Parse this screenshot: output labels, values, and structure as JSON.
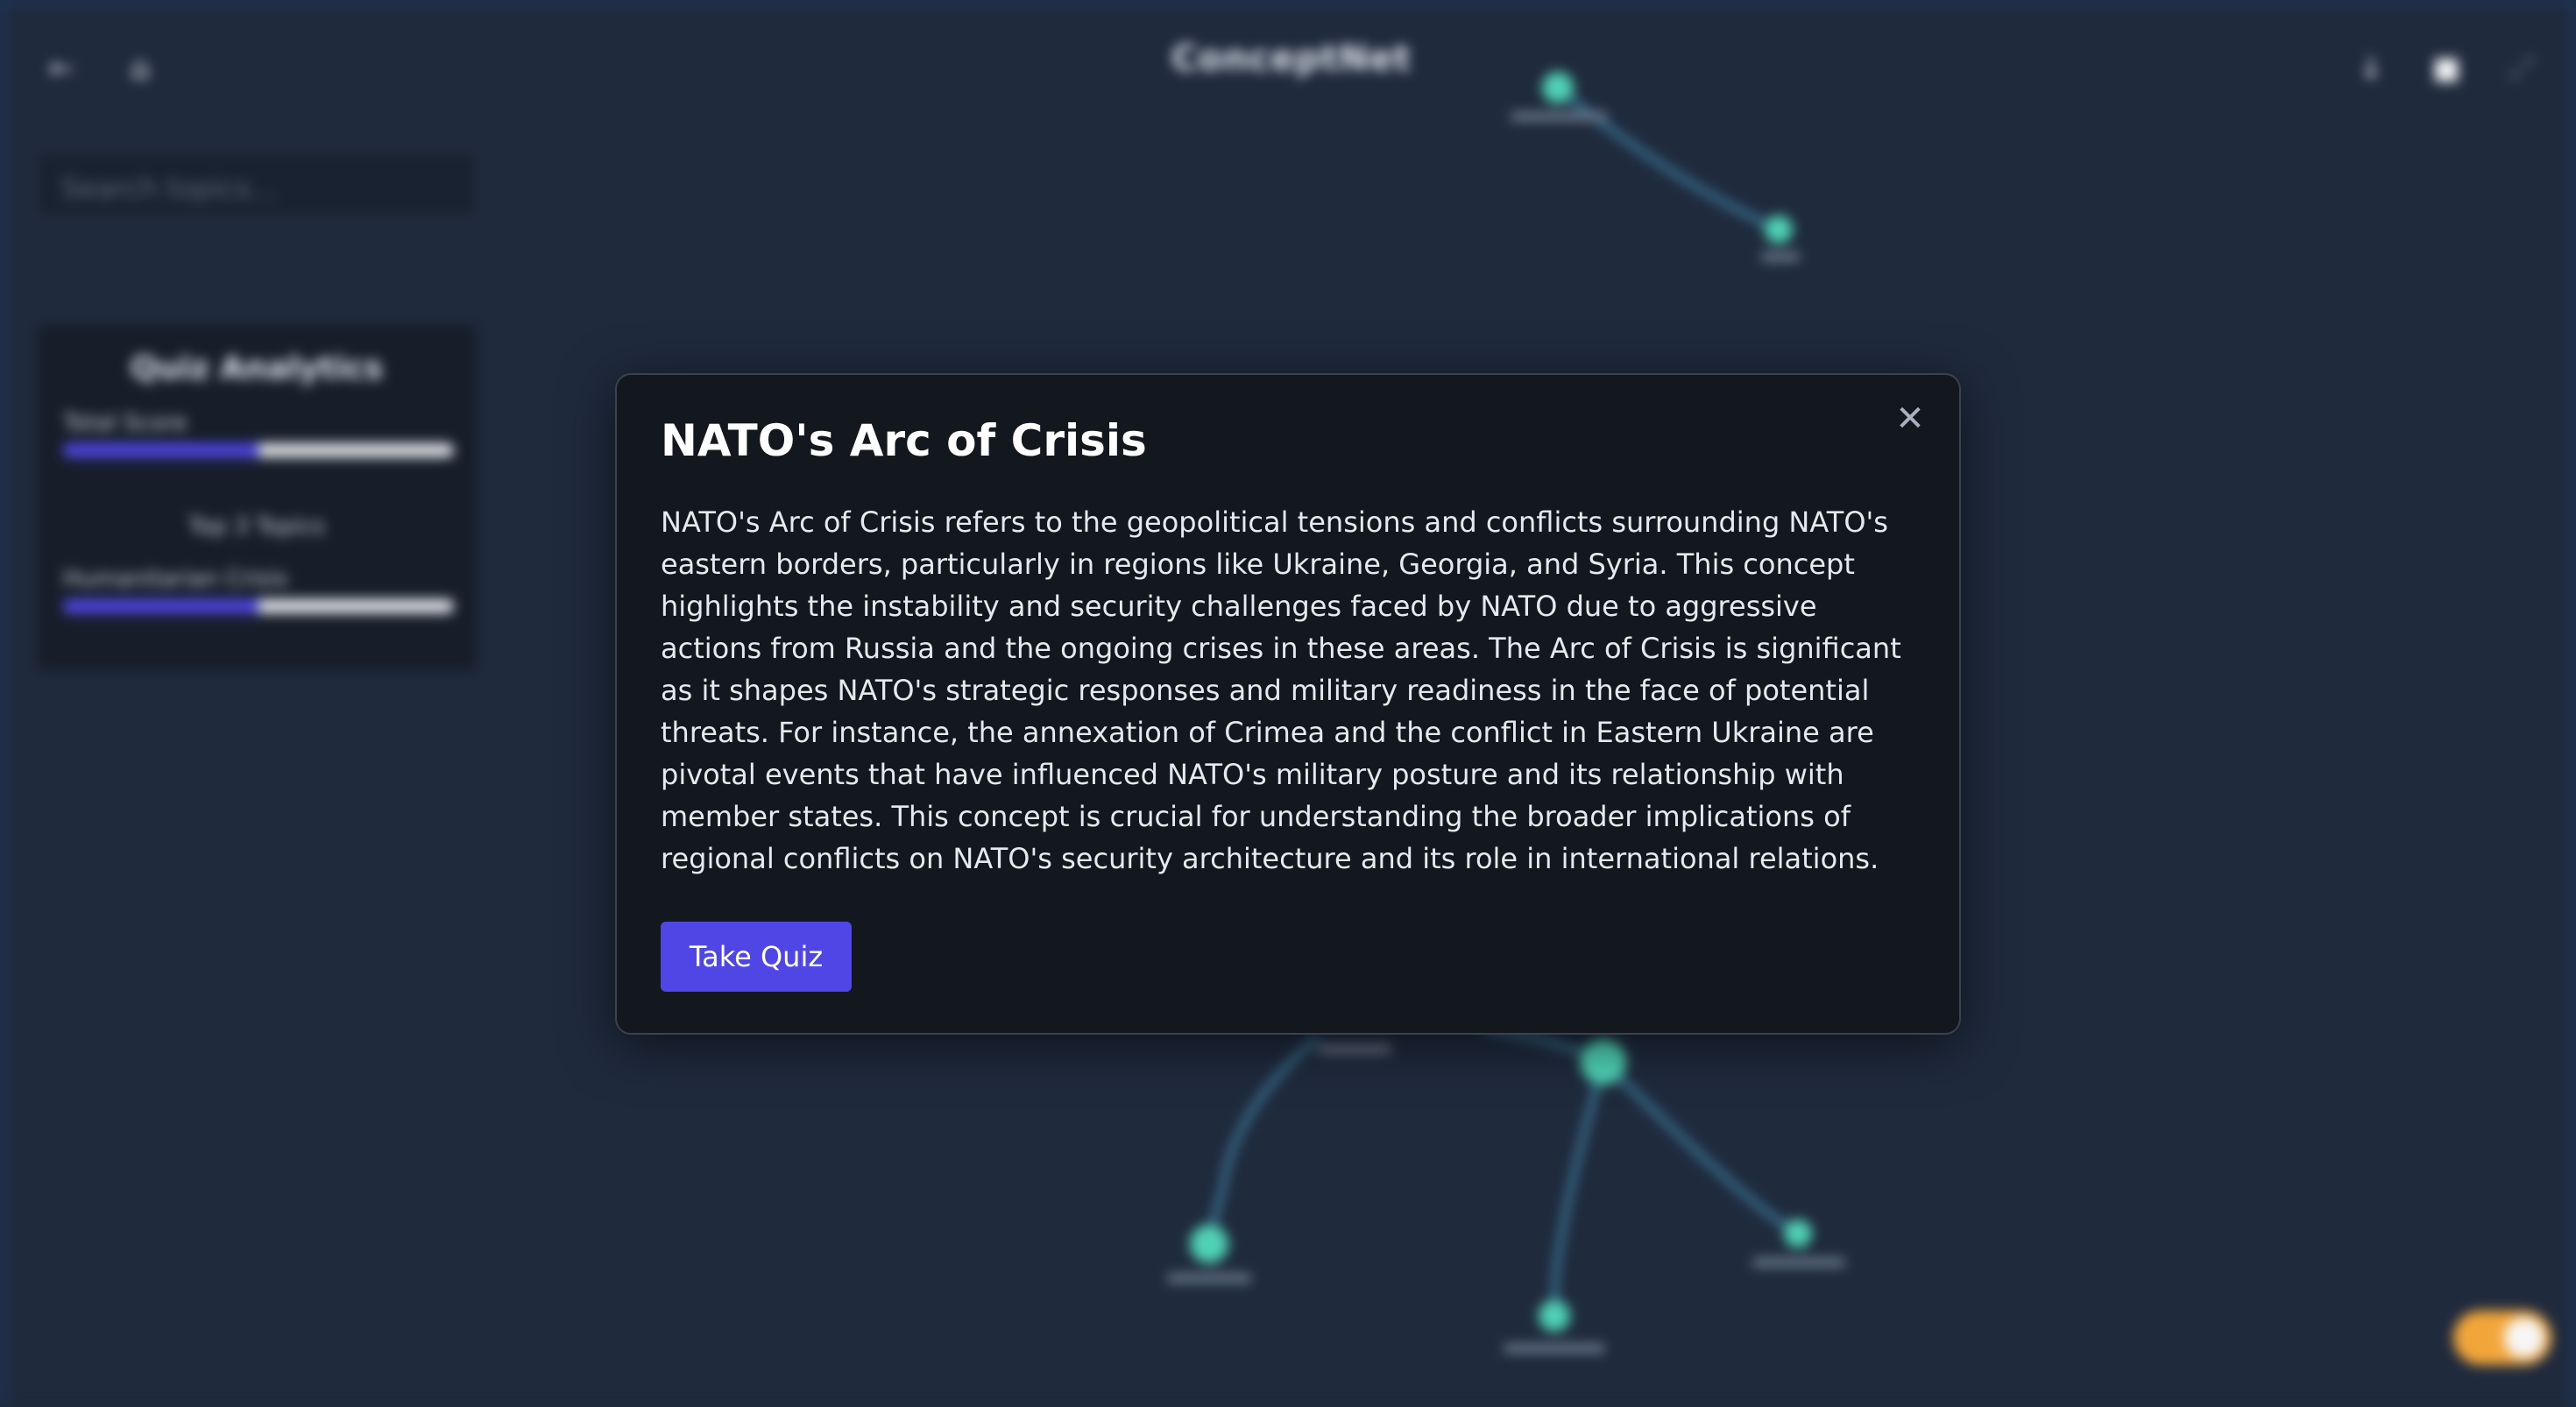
{
  "app": {
    "title": "ConceptNet",
    "search_placeholder": "Search topics...",
    "icons": [
      "back-arrow-icon",
      "home-icon",
      "download-icon",
      "trash-icon",
      "expand-icon"
    ]
  },
  "analytics": {
    "title": "Quiz Analytics",
    "total_score_label": "Total Score",
    "total_score_progress": 0.5,
    "top_topics_label": "Top 3 Topics",
    "topic_label": "Humanitarian Crisis",
    "topic_progress": 0.5
  },
  "modal": {
    "title": "NATO's Arc of Crisis",
    "body": "NATO's Arc of Crisis refers to the geopolitical tensions and conflicts surrounding NATO's eastern borders, particularly in regions like Ukraine, Georgia, and Syria. This concept highlights the instability and security challenges faced by NATO due to aggressive actions from Russia and the ongoing crises in these areas. The Arc of Crisis is significant as it shapes NATO's strategic responses and military readiness in the face of potential threats. For instance, the annexation of Crimea and the conflict in Eastern Ukraine are pivotal events that have influenced NATO's military posture and its relationship with member states. This concept is crucial for understanding the broader implications of regional conflicts on NATO's security architecture and its role in international relations.",
    "quiz_button": "Take Quiz",
    "close_icon": "close-icon"
  },
  "colors": {
    "background": "#1f2a3d",
    "node": "#4fd1b5",
    "edge": "#4aa3c9",
    "accent": "#4f46e5",
    "toggle": "#f2a63a"
  }
}
